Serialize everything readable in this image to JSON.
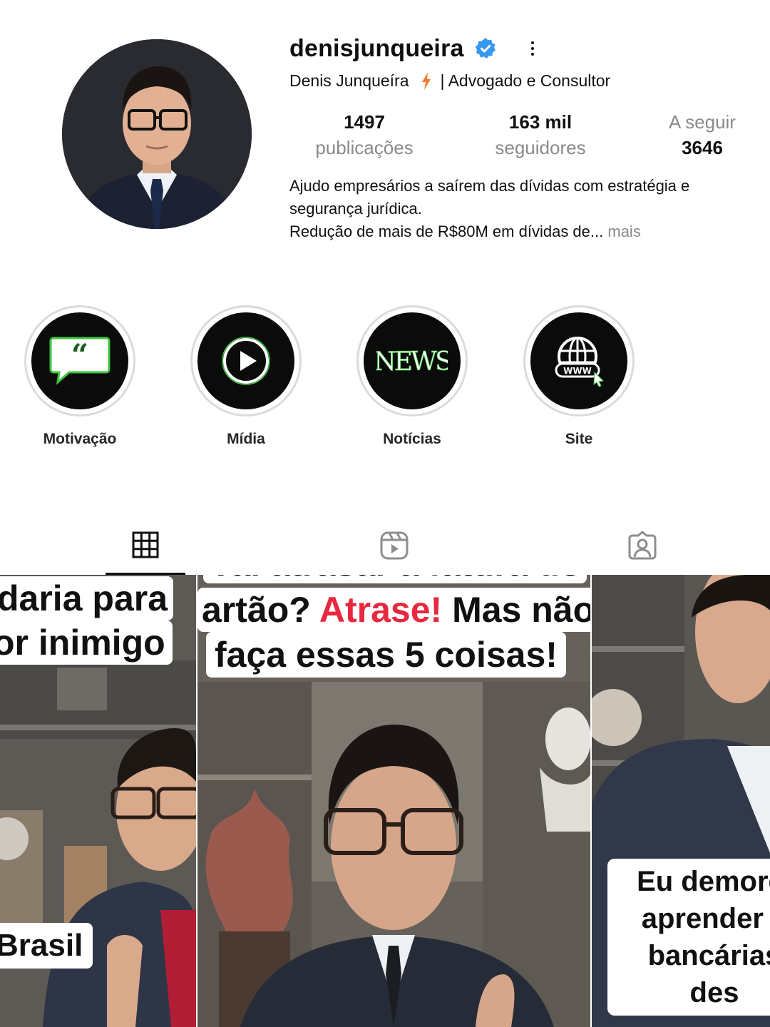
{
  "profile": {
    "username": "denisjunqueira",
    "full_name": "Denis Junqueíra",
    "title_suffix": "| Advogado e Consultor",
    "verified": true,
    "stats": {
      "posts_count": "1497",
      "posts_label": "publicações",
      "followers_count": "163 mil",
      "followers_label": "seguidores",
      "following_label": "A seguir",
      "following_count": "3646"
    },
    "bio_line1": "Ajudo empresários a saírem das dívidas com estratégia e",
    "bio_line2": "segurança jurídica.",
    "bio_line3": "Redução de mais de R$80M em dívidas de...",
    "bio_more": "mais"
  },
  "highlights": [
    {
      "label": "Motivação",
      "icon": "quote-icon"
    },
    {
      "label": "Mídia",
      "icon": "play-icon"
    },
    {
      "label": "Notícias",
      "icon": "news-icon"
    },
    {
      "label": "Site",
      "icon": "globe-www-icon"
    }
  ],
  "tabs": [
    {
      "name": "posts",
      "icon": "grid-icon",
      "active": true
    },
    {
      "name": "reels",
      "icon": "reels-icon",
      "active": false
    },
    {
      "name": "tagged",
      "icon": "tagged-icon",
      "active": false
    }
  ],
  "posts": [
    {
      "caption_line1": "daria para",
      "caption_line2": "or inimigo",
      "caption_bottom": "Brasil"
    },
    {
      "caption_line0": "Vai atrasar a fatura do",
      "caption_prefix": "artão?",
      "caption_highlight": "Atrase!",
      "caption_suffix": "Mas não",
      "caption_line2": "faça essas 5 coisas!"
    },
    {
      "caption_line1": "Eu demorei",
      "caption_line2": "aprender a",
      "caption_line3": "bancárias",
      "caption_line4": "des"
    }
  ],
  "colors": {
    "verified_blue": "#3897f0",
    "bolt_orange": "#f57c2b",
    "highlight_green": "#3ec63e",
    "caption_red": "#e8283f",
    "muted_text": "#8a8a8a"
  }
}
